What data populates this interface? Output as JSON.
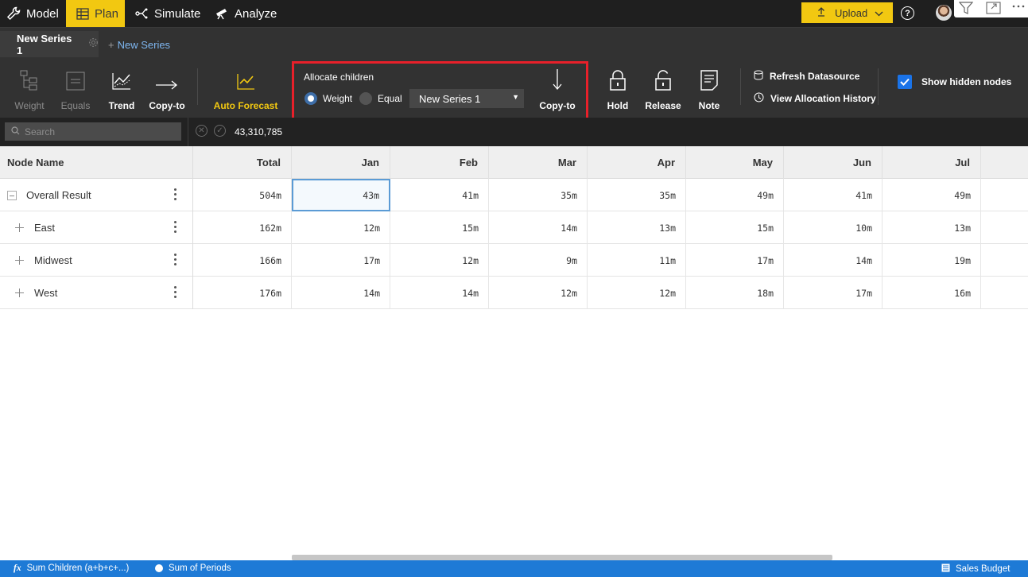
{
  "nav": {
    "tabs": [
      {
        "label": "Model",
        "icon": "wrench-icon"
      },
      {
        "label": "Plan",
        "icon": "table-icon",
        "active": true
      },
      {
        "label": "Simulate",
        "icon": "branch-icon"
      },
      {
        "label": "Analyze",
        "icon": "telescope-icon"
      }
    ],
    "upload_label": "Upload",
    "help": "?",
    "accent_color": "#f2c811"
  },
  "series": {
    "active": "New Series 1",
    "new_label": "New Series",
    "new_prefix": "+"
  },
  "ribbon": {
    "weight": "Weight",
    "equals": "Equals",
    "trend": "Trend",
    "copy_to": "Copy-to",
    "auto_forecast": "Auto Forecast",
    "allocate": {
      "title": "Allocate children",
      "weight": "Weight",
      "equal": "Equal",
      "selected": "Weight",
      "series_value": "New Series 1",
      "copy_to": "Copy-to"
    },
    "hold": "Hold",
    "release": "Release",
    "note": "Note",
    "refresh": "Refresh Datasource",
    "history": "View Allocation History",
    "show_hidden": "Show hidden nodes",
    "show_hidden_checked": true,
    "highlight_color": "#e8202a"
  },
  "search": {
    "placeholder": "Search",
    "formula_value": "43,310,785"
  },
  "grid": {
    "headers": [
      "Node Name",
      "Total",
      "Jan",
      "Feb",
      "Mar",
      "Apr",
      "May",
      "Jun",
      "Jul"
    ],
    "rows": [
      {
        "name": "Overall Result",
        "expander": "minus",
        "values": [
          "504m",
          "43m",
          "41m",
          "35m",
          "35m",
          "49m",
          "41m",
          "49m"
        ]
      },
      {
        "name": "East",
        "expander": "plus",
        "values": [
          "162m",
          "12m",
          "15m",
          "14m",
          "13m",
          "15m",
          "10m",
          "13m"
        ]
      },
      {
        "name": "Midwest",
        "expander": "plus",
        "values": [
          "166m",
          "17m",
          "12m",
          "9m",
          "11m",
          "17m",
          "14m",
          "19m"
        ]
      },
      {
        "name": "West",
        "expander": "plus",
        "values": [
          "176m",
          "14m",
          "14m",
          "12m",
          "12m",
          "18m",
          "17m",
          "16m"
        ]
      }
    ]
  },
  "status": {
    "formula_symbol": "fx",
    "sum_children": "Sum Children (a+b+c+...)",
    "sum_periods": "Sum of Periods",
    "scenario": "Sales Budget"
  }
}
